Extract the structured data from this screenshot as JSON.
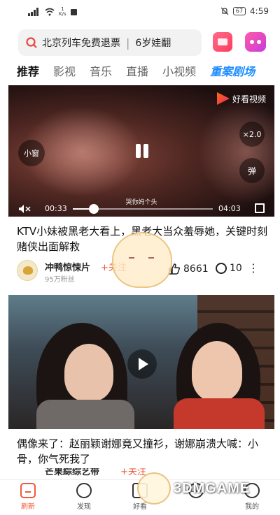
{
  "status_bar": {
    "net_speed": "1\nK/s",
    "battery": "67",
    "time": "4:59"
  },
  "search": {
    "query": "北京列车免费退票",
    "suggestion": "6岁娃翻"
  },
  "tabs": [
    "推荐",
    "影视",
    "音乐",
    "直播",
    "小视频",
    "重案剧场"
  ],
  "video1": {
    "brand": "好看视频",
    "small_window": "小窗",
    "speed": "×2.0",
    "danmu": "弹",
    "subtitle": "哭你妈个头",
    "current_time": "00:33",
    "total_time": "04:03",
    "progress": 0.15
  },
  "post1": {
    "title": "KTV小妹被黑老大看上，黑老大当众羞辱她，关键时刻赌侠出面解救",
    "author": "冲鸭惊悚片",
    "follow": "+关注",
    "fans": "95万粉丝",
    "likes": "8661",
    "comments": "10",
    "more": "⋮"
  },
  "post2": {
    "title": "偶像来了：赵丽颖谢娜竟又撞衫，谢娜崩溃大喊：小骨，你气死我了",
    "author": "芒果綜综艺带",
    "follow": "+关注"
  },
  "bottom_nav": [
    "刷新",
    "发现",
    "好看",
    "Live",
    "我的"
  ],
  "watermark": "3DMGAME"
}
